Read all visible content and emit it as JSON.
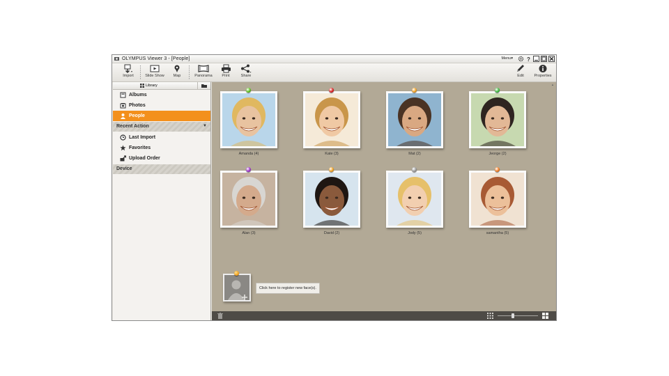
{
  "window": {
    "title": "OLYMPUS Viewer 3 - [People]",
    "menu_label": "Menu▾"
  },
  "toolbar": {
    "import": "Import",
    "slideshow": "Slide Show",
    "map": "Map",
    "panorama": "Panorama",
    "print": "Print",
    "share": "Share",
    "edit": "Edit",
    "properties": "Properties"
  },
  "sidebar": {
    "library_tab": "Library",
    "library_items": [
      {
        "label": "Albums",
        "icon": "album-icon"
      },
      {
        "label": "Photos",
        "icon": "photos-icon"
      },
      {
        "label": "People",
        "icon": "person-icon",
        "selected": true
      }
    ],
    "recent_action": {
      "title": "Recent Action",
      "items": [
        {
          "label": "Last Import",
          "icon": "clock-icon"
        },
        {
          "label": "Favorites",
          "icon": "star-icon"
        },
        {
          "label": "Upload Order",
          "icon": "upload-icon"
        }
      ]
    },
    "device": {
      "title": "Device"
    }
  },
  "people": [
    {
      "name": "Amanda (4)",
      "pin": "#5cc21c"
    },
    {
      "name": "Kate (3)",
      "pin": "#d91e1e"
    },
    {
      "name": "Mat (2)",
      "pin": "#f0a020"
    },
    {
      "name": "Jeorge (2)",
      "pin": "#3cb83c"
    },
    {
      "name": "Alan (3)",
      "pin": "#9b2ec9"
    },
    {
      "name": "David (2)",
      "pin": "#f0a020"
    },
    {
      "name": "Jody (5)",
      "pin": "#9a9a9a"
    },
    {
      "name": "samantha (5)",
      "pin": "#f07a20"
    }
  ],
  "register": {
    "hint": "Click here to register new face(s)."
  },
  "colors": {
    "accent": "#f3901c",
    "content_bg": "#b2a996",
    "bottombar_bg": "#4e4b46"
  }
}
